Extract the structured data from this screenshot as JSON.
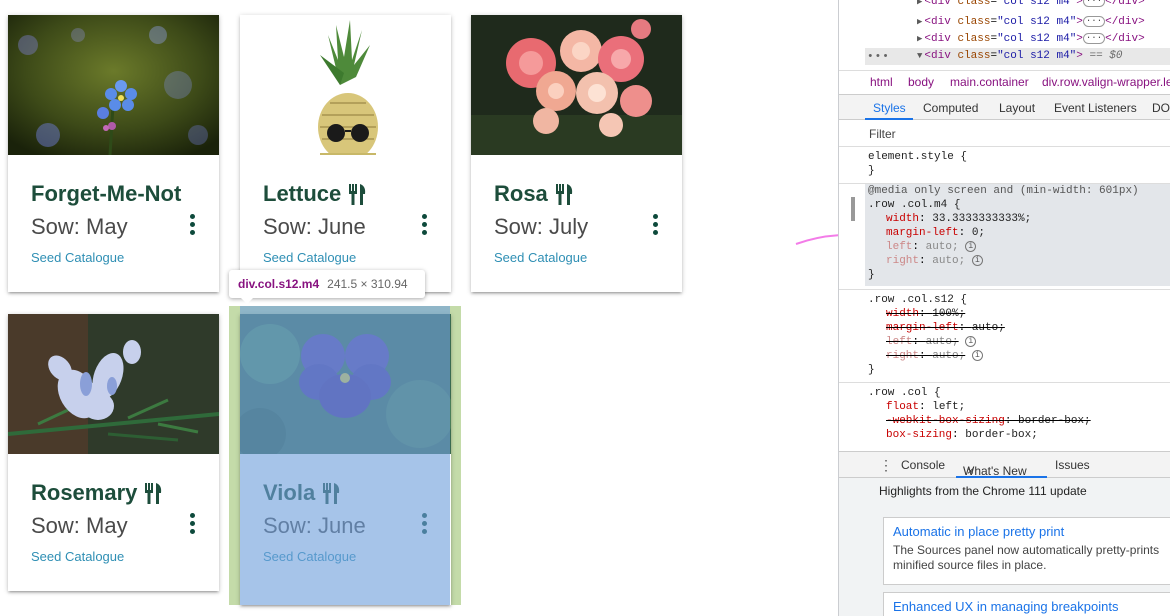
{
  "cards": [
    {
      "title": "Forget-Me-Not",
      "sow": "Sow: May",
      "link": "Seed Catalogue",
      "has_icon": false,
      "image": "forget-me-not-flower"
    },
    {
      "title": "Lettuce",
      "sow": "Sow: June",
      "link": "Seed Catalogue",
      "has_icon": true,
      "image": "pineapple-with-sunglasses"
    },
    {
      "title": "Rosa",
      "sow": "Sow: July",
      "link": "Seed Catalogue",
      "has_icon": true,
      "image": "pink-roses"
    },
    {
      "title": "Rosemary",
      "sow": "Sow: May",
      "link": "Seed Catalogue",
      "has_icon": true,
      "image": "rosemary-flower"
    },
    {
      "title": "Viola",
      "sow": "Sow: June",
      "link": "Seed Catalogue",
      "has_icon": true,
      "image": "purple-viola-flower"
    }
  ],
  "tooltip": {
    "tag": "div.col.s12.m4",
    "dims": "241.5 × 310.94"
  },
  "colors": {
    "title": "#1d4d3b",
    "link": "#2f8fb4",
    "highlight_content": "#6fa0dc",
    "highlight_margin": "#c4dba9",
    "arrow": "#f37ce8"
  },
  "devtools": {
    "dom_lines": [
      {
        "open": "<",
        "tag": "div",
        "attr": "class",
        "value": "\"col s12 m4\"",
        "close": ">",
        "end": "</div>",
        "selected": false
      },
      {
        "open": "<",
        "tag": "div",
        "attr": "class",
        "value": "\"col s12 m4\"",
        "close": ">",
        "end": "</div>",
        "selected": false
      },
      {
        "open": "<",
        "tag": "div",
        "attr": "class",
        "value": "\"col s12 m4\"",
        "close": ">",
        "end": "</div>",
        "selected": false
      },
      {
        "open": "<",
        "tag": "div",
        "attr": "class",
        "value": "\"col s12 m4\"",
        "close": ">",
        "end": "== $0",
        "selected": true
      }
    ],
    "dom_dots": "•••",
    "breadcrumbs": [
      "html",
      "body",
      "main.container",
      "div.row.valign-wrapper.le"
    ],
    "tabs": [
      "Styles",
      "Computed",
      "Layout",
      "Event Listeners",
      "DO"
    ],
    "filter_placeholder": "Filter",
    "rules": {
      "element_style": {
        "selector": "element.style {",
        "close": "}"
      },
      "media": {
        "query": "@media only screen and (min-width: 601px)",
        "selector": ".row .col.m4 {",
        "props": [
          {
            "name": "width",
            "value": "33.3333333333%;"
          },
          {
            "name": "margin-left",
            "value": "0;"
          },
          {
            "name": "left",
            "value": "auto;"
          },
          {
            "name": "right",
            "value": "auto;"
          }
        ],
        "close": "}"
      },
      "s12": {
        "selector": ".row .col.s12 {",
        "props": [
          {
            "name": "width",
            "value": "100%;"
          },
          {
            "name": "margin-left",
            "value": "auto;"
          },
          {
            "name": "left",
            "value": "auto;"
          },
          {
            "name": "right",
            "value": "auto;"
          }
        ],
        "close": "}"
      },
      "col": {
        "selector": ".row .col {",
        "props": [
          {
            "name": "float",
            "value": "left;"
          },
          {
            "name": "-webkit-box-sizing",
            "value": "border-box;"
          },
          {
            "name": "box-sizing",
            "value": "border-box;"
          }
        ]
      }
    },
    "info_glyph": "i",
    "drawer_tabs": [
      "Console",
      "What's New",
      "Issues"
    ],
    "drawer_close": "×",
    "drawer_menu": "⋮",
    "whats_new": {
      "header": "Highlights from the Chrome 111 update",
      "items": [
        {
          "title": "Automatic in place pretty print",
          "desc": "The Sources panel now automatically pretty-prints minified source files in place."
        },
        {
          "title": "Enhanced UX in managing breakpoints",
          "desc": ""
        }
      ]
    }
  }
}
